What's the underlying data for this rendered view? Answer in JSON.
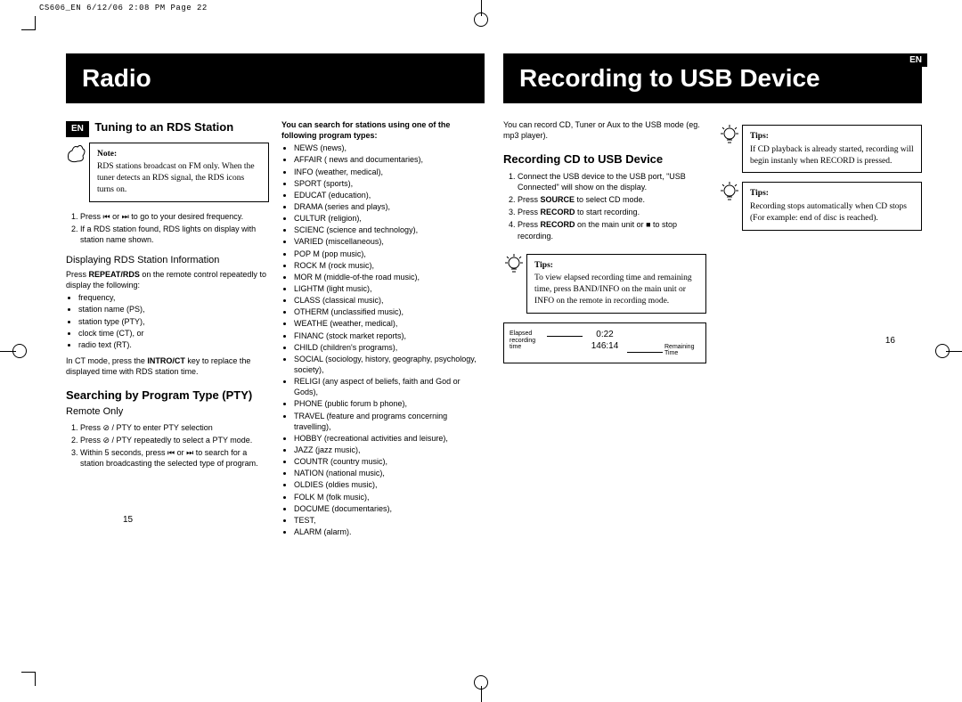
{
  "header": "CS606_EN  6/12/06  2:08 PM  Page 22",
  "lang_badge": "EN",
  "page_numbers": {
    "left": "15",
    "right": "16"
  },
  "left": {
    "title": "Radio",
    "sec1": "Tuning to an RDS Station",
    "note_label": "Note:",
    "note_text": "RDS stations broadcast on FM only. When the tuner detects an RDS signal, the RDS icons turns on.",
    "steps1": [
      "Press  ⏮ or ⏭  to go to your desired frequency.",
      "If a RDS station found, RDS lights on display with station name shown."
    ],
    "sub1": "Displaying RDS Station Information",
    "sub1_intro_a": "Press ",
    "sub1_intro_bold": "REPEAT/RDS",
    "sub1_intro_b": " on the remote control repeatedly to display the following:",
    "sub1_items": [
      "frequency,",
      "station name (PS),",
      "station type (PTY),",
      "clock time (CT), or",
      "radio text (RT)."
    ],
    "sub1_tail_a": "In CT mode, press the ",
    "sub1_tail_bold": "INTRO/CT",
    "sub1_tail_b": " key to replace the displayed time with RDS station time.",
    "sec2": "Searching by Program Type (PTY)",
    "sec2_sub": "Remote Only",
    "steps2": [
      "Press  ⊘ / PTY to enter PTY selection",
      "Press  ⊘ / PTY repeatedly to select a PTY mode.",
      "Within 5 seconds, press  ⏮ or ⏭  to search for a station broadcasting the selected type of program."
    ],
    "pty_intro": "You can search for stations using one of the following program types:",
    "pty_list": [
      "NEWS (news),",
      "AFFAIR ( news and documentaries),",
      "INFO (weather, medical),",
      "SPORT (sports),",
      "EDUCAT (education),",
      "DRAMA (series and plays),",
      "CULTUR (religion),",
      "SCIENC (science and technology),",
      "VARIED (miscellaneous),",
      "POP M (pop music),",
      "ROCK M (rock music),",
      "MOR M (middle-of-the road music),",
      "LIGHTM (light music),",
      "CLASS (classical music),",
      "OTHERM (unclassified music),",
      "WEATHE (weather, medical),",
      "FINANC (stock market reports),",
      "CHILD (children's programs),",
      "SOCIAL (sociology, history, geography, psychology, society),",
      "RELIGI (any aspect of beliefs, faith and God or Gods),",
      "PHONE (public forum b phone),",
      "TRAVEL (feature and programs concerning travelling),",
      "HOBBY (recreational activities and leisure),",
      "JAZZ (jazz music),",
      "COUNTR (country music),",
      "NATION (national music),",
      "OLDIES (oldies music),",
      "FOLK M (folk music),",
      "DOCUME (documentaries),",
      "TEST,",
      "ALARM (alarm)."
    ]
  },
  "right": {
    "title": "Recording to USB Device",
    "intro": "You can record CD, Tuner or Aux to the USB mode (eg. mp3 player).",
    "sec1": "Recording CD to USB Device",
    "steps": [
      "Connect the USB device to the USB port, \"USB Connected\" will show on the display.",
      "Press SOURCE to select CD mode.",
      "Press RECORD to start recording.",
      "Press RECORD on the main unit or ■ to stop recording."
    ],
    "tip1_label": "Tips:",
    "tip1_text": "To view elapsed recording time and remaining time, press BAND/INFO on the main unit or INFO on the remote in recording mode.",
    "display": {
      "left_label": "Elapsed recording time",
      "right_label": "Remaining Time",
      "val1": "0:22",
      "val2": "146:14"
    },
    "tip2_label": "Tips:",
    "tip2_text": "If CD playback is already started, recording will begin instanly when RECORD is pressed.",
    "tip3_label": "Tips:",
    "tip3_text": "Recording stops automatically when CD stops (For example: end of disc is reached)."
  }
}
